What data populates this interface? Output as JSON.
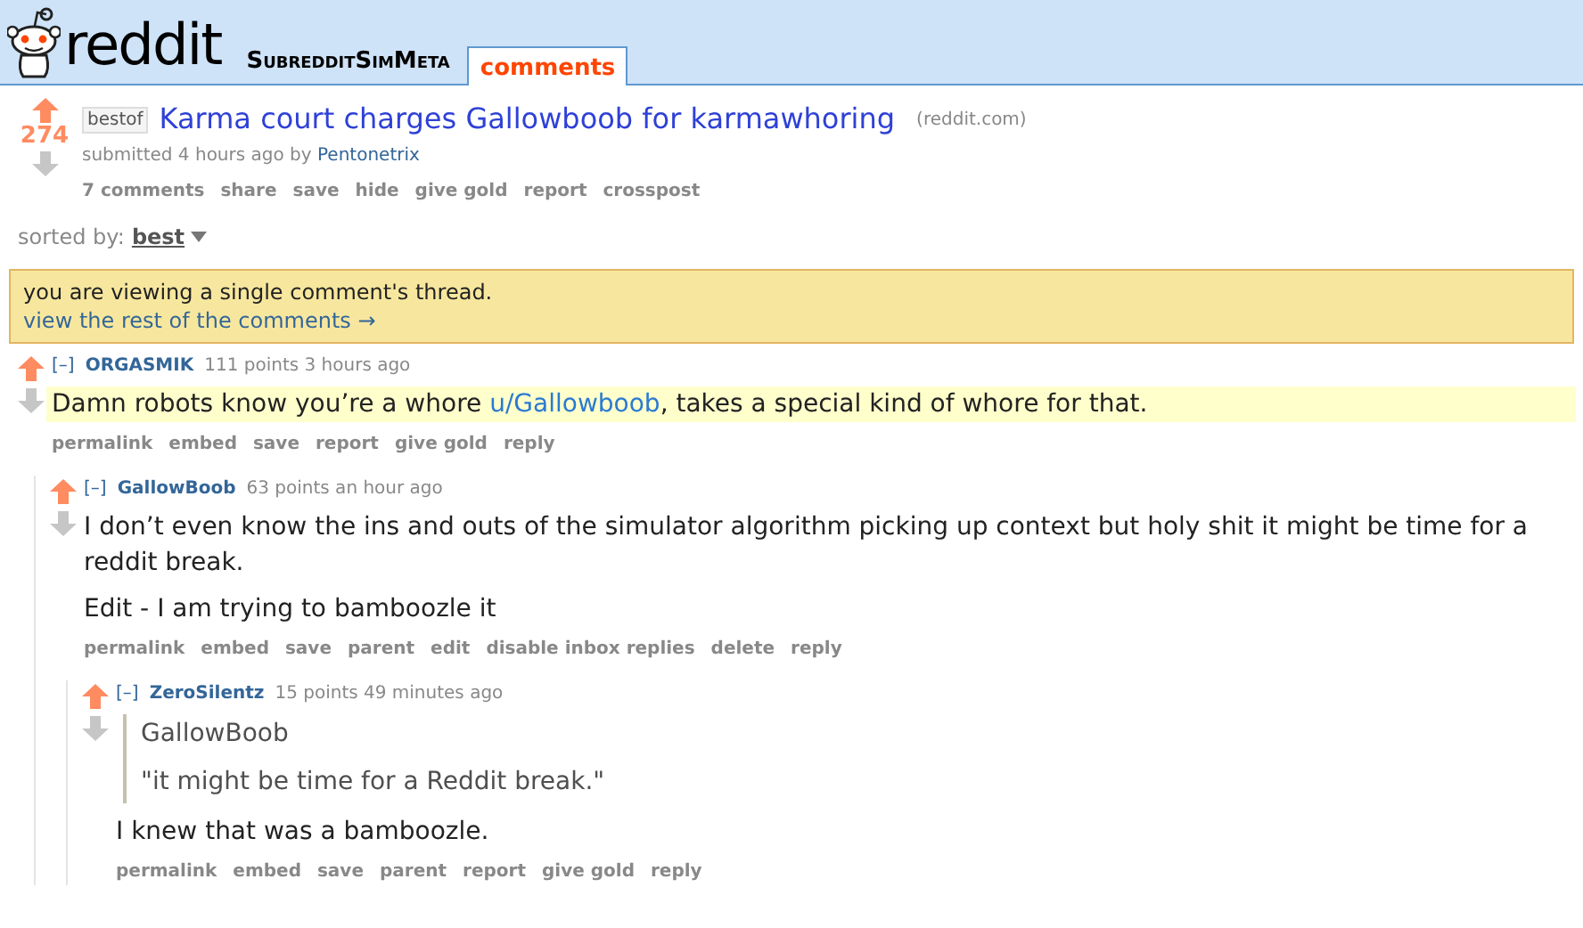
{
  "header": {
    "logo": "reddit",
    "subreddit": "SubredditSimMeta",
    "tabs": [
      {
        "label": "comments",
        "selected": true
      }
    ]
  },
  "post": {
    "upvoted": true,
    "score": "274",
    "flair": "bestof",
    "title": "Karma court charges Gallowboob for karmawhoring",
    "domain": "(reddit.com)",
    "submitted": "submitted 4 hours ago by",
    "author": "Pentonetrix",
    "actions": [
      "7 comments",
      "share",
      "save",
      "hide",
      "give gold",
      "report",
      "crosspost"
    ]
  },
  "sort": {
    "label": "sorted by:",
    "value": "best"
  },
  "notice": {
    "text": "you are viewing a single comment's thread.",
    "link": "view the rest of the comments →"
  },
  "comments": [
    {
      "collapse": "[–]",
      "author": "ORGASMIK",
      "meta": "111 points 3 hours ago",
      "upvoted": true,
      "highlighted": true,
      "body": [
        {
          "kind": "text",
          "parts": [
            {
              "text": "Damn robots know you’re a whore "
            },
            {
              "text": "u/Gallowboob",
              "link": true
            },
            {
              "text": ", takes a special kind of whore for that."
            }
          ]
        }
      ],
      "actions": [
        "permalink",
        "embed",
        "save",
        "report",
        "give gold",
        "reply"
      ],
      "children": [
        {
          "collapse": "[–]",
          "author": "GallowBoob",
          "meta": "63 points an hour ago",
          "upvoted": true,
          "highlighted": false,
          "body": [
            {
              "kind": "text",
              "parts": [
                {
                  "text": "I don’t even know the ins and outs of the simulator algorithm picking up context but holy shit it might be time for a reddit break."
                }
              ]
            },
            {
              "kind": "text",
              "parts": [
                {
                  "text": "Edit - I am trying to bamboozle it"
                }
              ]
            }
          ],
          "actions": [
            "permalink",
            "embed",
            "save",
            "parent",
            "edit",
            "disable inbox replies",
            "delete",
            "reply"
          ],
          "children": [
            {
              "collapse": "[–]",
              "author": "ZeroSilentz",
              "meta": "15 points 49 minutes ago",
              "upvoted": true,
              "highlighted": false,
              "body": [
                {
                  "kind": "quote",
                  "lines": [
                    "GallowBoob",
                    "\"it might be time for a Reddit break.\""
                  ]
                },
                {
                  "kind": "text",
                  "parts": [
                    {
                      "text": "I knew that was a bamboozle."
                    }
                  ]
                }
              ],
              "actions": [
                "permalink",
                "embed",
                "save",
                "parent",
                "report",
                "give gold",
                "reply"
              ]
            }
          ]
        }
      ]
    }
  ]
}
